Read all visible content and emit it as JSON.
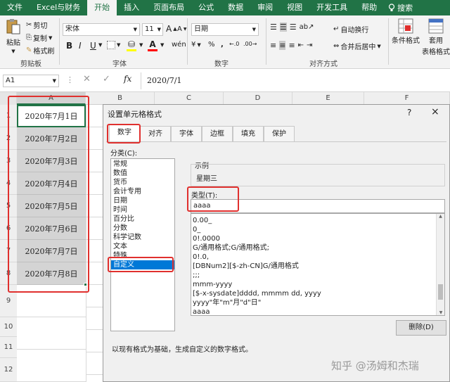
{
  "ribbon_tabs": [
    "文件",
    "Excel与财务",
    "开始",
    "插入",
    "页面布局",
    "公式",
    "数据",
    "审阅",
    "视图",
    "开发工具",
    "帮助"
  ],
  "active_tab_index": 2,
  "search_label": "搜索",
  "clipboard": {
    "paste": "粘贴",
    "cut": "剪切",
    "copy": "复制",
    "format_painter": "格式刷",
    "group": "剪贴板"
  },
  "font": {
    "name": "宋体",
    "size": "11",
    "bold": "B",
    "italic": "I",
    "underline": "U",
    "grow": "A",
    "shrink": "A",
    "fill_color": "#ffff00",
    "font_color": "#ff0000",
    "group": "字体"
  },
  "number": {
    "format": "日期",
    "percent": "%",
    "comma": ",",
    "group": "数字"
  },
  "alignment": {
    "wrap": "自动换行",
    "merge": "合并后居中",
    "group": "对齐方式"
  },
  "styles": {
    "conditional": "条件格式",
    "table_format_1": "套用",
    "table_format_2": "表格格式"
  },
  "formula_bar": {
    "name_box": "A1",
    "fx": "fx",
    "value": "2020/7/1"
  },
  "columns": [
    "A",
    "B",
    "C",
    "D",
    "E",
    "F"
  ],
  "rows": [
    "1",
    "2",
    "3",
    "4",
    "5",
    "6",
    "7",
    "8",
    "9",
    "10",
    "11",
    "12"
  ],
  "cells": [
    "2020年7月1日",
    "2020年7月2日",
    "2020年7月3日",
    "2020年7月4日",
    "2020年7月5日",
    "2020年7月6日",
    "2020年7月7日",
    "2020年7月8日"
  ],
  "dialog": {
    "title": "设置单元格格式",
    "help": "?",
    "close": "×",
    "tabs": [
      "数字",
      "对齐",
      "字体",
      "边框",
      "填充",
      "保护"
    ],
    "category_label": "分类(C):",
    "categories": [
      "常规",
      "数值",
      "货币",
      "会计专用",
      "日期",
      "时间",
      "百分比",
      "分数",
      "科学记数",
      "文本",
      "特殊",
      "自定义"
    ],
    "selected_category_index": 11,
    "sample_label": "示例",
    "sample_value": "星期三",
    "type_label": "类型(T):",
    "type_value": "aaaa",
    "type_list": [
      "0.00_",
      "0_",
      "0!.0000",
      "G/通用格式;G/通用格式;",
      "0!.0,",
      "[DBNum2][$-zh-CN]G/通用格式",
      ";;;",
      "mmm-yyyy",
      "[$-x-sysdate]dddd, mmmm dd, yyyy",
      "yyyy\"年\"m\"月\"d\"日\"",
      "aaaa"
    ],
    "delete_button": "删除(D)",
    "description": "以现有格式为基础，生成自定义的数字格式。"
  },
  "watermark": "知乎 @汤姆和杰瑞",
  "colors": {
    "excel_green": "#217346",
    "highlight_red": "#e0302e",
    "selection_blue": "#0078d7"
  }
}
